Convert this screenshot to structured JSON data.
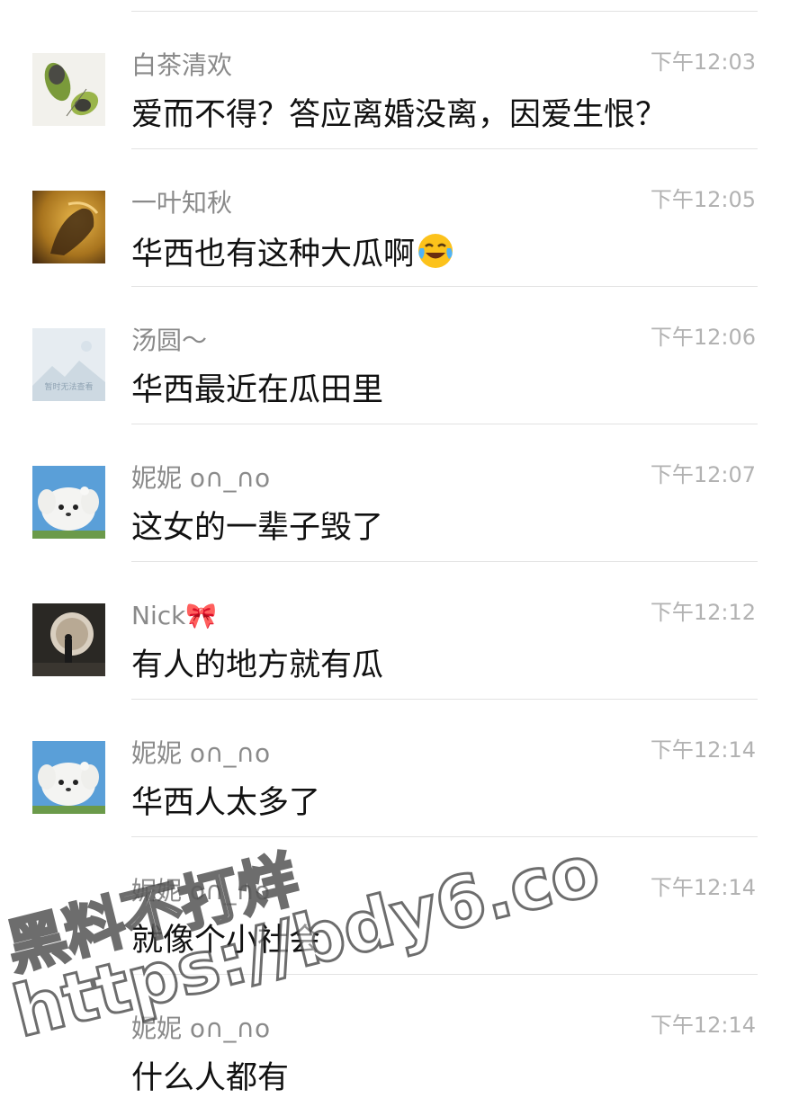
{
  "messages": [
    {
      "name": "白茶清欢",
      "time": "下午12:03",
      "text": "爱而不得？答应离婚没离，因爱生恨？",
      "avatar": "leaf-avatar"
    },
    {
      "name": "一叶知秋",
      "time": "下午12:05",
      "text": "华西也有这种大瓜啊",
      "emoji": "crying-laughing-emoji",
      "avatar": "golden-art-avatar"
    },
    {
      "name": "汤圆～",
      "time": "下午12:06",
      "text": "华西最近在瓜田里",
      "avatar": "placeholder-avatar",
      "avatar_caption": "暂时无法查看"
    },
    {
      "name": "妮妮 o∩_∩o",
      "time": "下午12:07",
      "text": "这女的一辈子毁了",
      "avatar": "white-dog-avatar"
    },
    {
      "name": "Nick🎀",
      "time": "下午12:12",
      "text": "有人的地方就有瓜",
      "avatar": "dark-room-avatar"
    },
    {
      "name": "妮妮 o∩_∩o",
      "time": "下午12:14",
      "text": "华西人太多了",
      "avatar": "white-dog-avatar"
    },
    {
      "name": "妮妮 o∩_∩o",
      "time": "下午12:14",
      "text": "就像个小社会",
      "avatar": ""
    },
    {
      "name": "妮妮 o∩_∩o",
      "time": "下午12:14",
      "text": "什么人都有",
      "avatar": ""
    }
  ],
  "watermark": {
    "line1": "黑料不打烊",
    "line2": "https://bdy6.co"
  }
}
